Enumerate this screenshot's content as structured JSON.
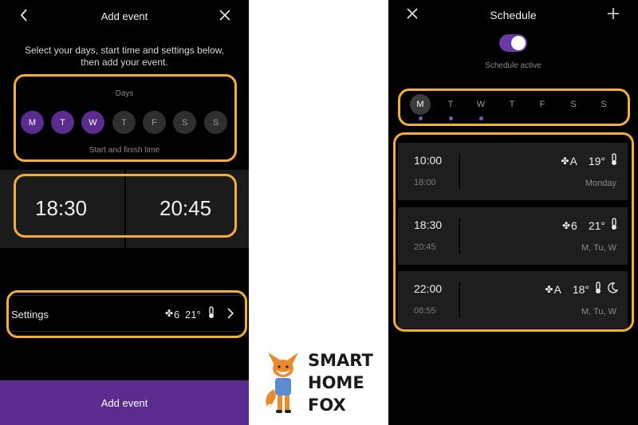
{
  "add_event_screen": {
    "title": "Add event",
    "instructions_line1": "Select your days, start time and settings below,",
    "instructions_line2": "then add your event.",
    "days_label": "Days",
    "days": [
      {
        "label": "M",
        "active": true
      },
      {
        "label": "T",
        "active": true
      },
      {
        "label": "W",
        "active": true
      },
      {
        "label": "T",
        "active": false
      },
      {
        "label": "F",
        "active": false
      },
      {
        "label": "S",
        "active": false
      },
      {
        "label": "S",
        "active": false
      }
    ],
    "time_label": "Start and finish time",
    "start_time": "18:30",
    "finish_time": "20:45",
    "settings": {
      "label": "Settings",
      "fan_value": "6",
      "temperature": "21°"
    },
    "add_button_label": "Add event"
  },
  "schedule_screen": {
    "title": "Schedule",
    "toggle_label": "Schedule active",
    "toggle_on": true,
    "weekdays": [
      {
        "label": "M",
        "selected": true,
        "has_event": true
      },
      {
        "label": "T",
        "selected": false,
        "has_event": true
      },
      {
        "label": "W",
        "selected": false,
        "has_event": true
      },
      {
        "label": "T",
        "selected": false,
        "has_event": false
      },
      {
        "label": "F",
        "selected": false,
        "has_event": false
      },
      {
        "label": "S",
        "selected": false,
        "has_event": false
      },
      {
        "label": "S",
        "selected": false,
        "has_event": false
      }
    ],
    "events": [
      {
        "start": "10:00",
        "end": "18:00",
        "fan": "A",
        "temp": "19°",
        "night": false,
        "days": "Monday"
      },
      {
        "start": "18:30",
        "end": "20:45",
        "fan": "6",
        "temp": "21°",
        "night": false,
        "days": "M, Tu, W"
      },
      {
        "start": "22:00",
        "end": "08:55",
        "fan": "A",
        "temp": "18°",
        "night": true,
        "days": "M, Tu, W"
      }
    ]
  },
  "logo": {
    "line1": "SMART",
    "line2": "HOME",
    "line3": "FOX"
  },
  "colors": {
    "accent_purple": "#5b2b8f",
    "highlight_orange": "#f4ad35",
    "background": "#000000"
  },
  "icons": [
    "back-chevron-icon",
    "close-icon",
    "fan-icon",
    "thermostat-icon",
    "chevron-right-icon",
    "plus-icon",
    "moon-icon",
    "fox-mascot-icon"
  ]
}
